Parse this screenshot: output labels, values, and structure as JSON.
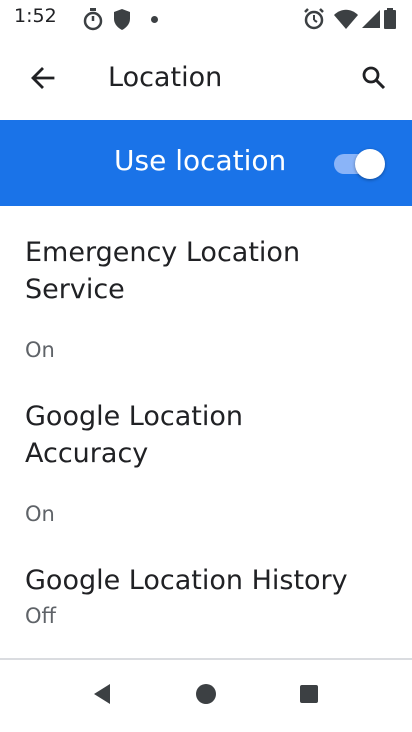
{
  "status_bar": {
    "time": "1:52",
    "left_icons": [
      "timer-icon",
      "shield-icon",
      "notification-dot-icon"
    ],
    "right_icons": [
      "alarm-icon",
      "wifi-icon",
      "cell-signal-icon",
      "battery-icon"
    ]
  },
  "app_bar": {
    "title": "Location",
    "back_icon": "arrow-back-icon",
    "search_icon": "search-icon"
  },
  "master_switch": {
    "label": "Use location",
    "enabled": true,
    "bar_color": "#1a73e8"
  },
  "items": [
    {
      "title": "Emergency Location Service",
      "summary": "On"
    },
    {
      "title": "Google Location Accuracy",
      "summary": "On"
    },
    {
      "title": "Google Location History",
      "summary": "Off"
    }
  ],
  "nav_bar": {
    "buttons": [
      "back-triangle-icon",
      "home-circle-icon",
      "recents-square-icon"
    ]
  }
}
